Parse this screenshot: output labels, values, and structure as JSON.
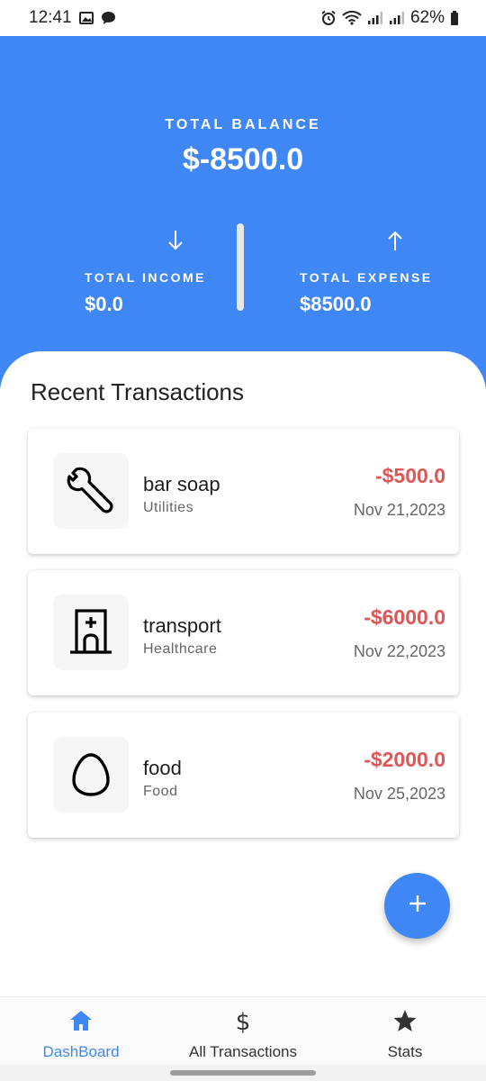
{
  "status_bar": {
    "time": "12:41",
    "battery": "62%",
    "icons": [
      "image-icon",
      "chat-bubble-icon",
      "alarm-icon",
      "wifi-icon",
      "signal-icon",
      "signal-icon",
      "battery-icon"
    ]
  },
  "header": {
    "balance_label": "TOTAL BALANCE",
    "balance_value": "$-8500.0",
    "income_label": "TOTAL INCOME",
    "income_value": "$0.0",
    "expense_label": "TOTAL EXPENSE",
    "expense_value": "$8500.0",
    "color": "#3f87f5"
  },
  "main": {
    "section_title": "Recent Transactions",
    "transactions": [
      {
        "name": "bar soap",
        "category": "Utilities",
        "amount": "-$500.0",
        "date": "Nov 21,2023",
        "icon": "wrench-icon"
      },
      {
        "name": "transport",
        "category": "Healthcare",
        "amount": "-$6000.0",
        "date": "Nov 22,2023",
        "icon": "hospital-icon"
      },
      {
        "name": "food",
        "category": "Food",
        "amount": "-$2000.0",
        "date": "Nov 25,2023",
        "icon": "egg-icon"
      }
    ],
    "amount_color": "#e05555"
  },
  "fab": {
    "icon": "plus-icon"
  },
  "bottom_nav": {
    "items": [
      {
        "label": "DashBoard",
        "icon": "home-icon",
        "active": true
      },
      {
        "label": "All Transactions",
        "icon": "dollar-icon",
        "active": false
      },
      {
        "label": "Stats",
        "icon": "star-icon",
        "active": false
      }
    ]
  }
}
